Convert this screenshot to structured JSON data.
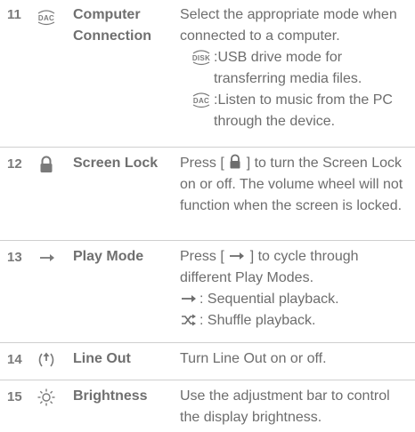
{
  "rows": [
    {
      "num": "11",
      "icon": "dac-icon",
      "name": "Computer Connection",
      "desc": "Select the appropriate mode when connected to a computer.",
      "subs": [
        {
          "icon": "disk-icon",
          "text": ":USB drive mode for transferring media files."
        },
        {
          "icon": "dac-icon",
          "text": ":Listen to music from the PC through the device."
        }
      ]
    },
    {
      "num": "12",
      "icon": "lock-icon",
      "name": "Screen Lock",
      "desc_prefix": "Press [",
      "desc_suffix": "] to turn the Screen Lock on or off. The volume wheel will not function when the screen is locked."
    },
    {
      "num": "13",
      "icon": "sequential-arrow-icon",
      "name": "Play Mode",
      "desc_prefix": "Press [",
      "desc_suffix": "] to cycle through different Play Modes.",
      "subs": [
        {
          "icon": "sequential-arrow-icon",
          "text": ": Sequential playback."
        },
        {
          "icon": "shuffle-icon",
          "text": ": Shuffle playback."
        }
      ]
    },
    {
      "num": "14",
      "icon": "line-out-icon",
      "name": "Line Out",
      "desc": "Turn Line Out on or off."
    },
    {
      "num": "15",
      "icon": "brightness-icon",
      "name": "Brightness",
      "desc": "Use the adjustment bar to control the display brightness."
    }
  ],
  "icon_labels": {
    "dac": "DAC",
    "disk": "DISK"
  }
}
